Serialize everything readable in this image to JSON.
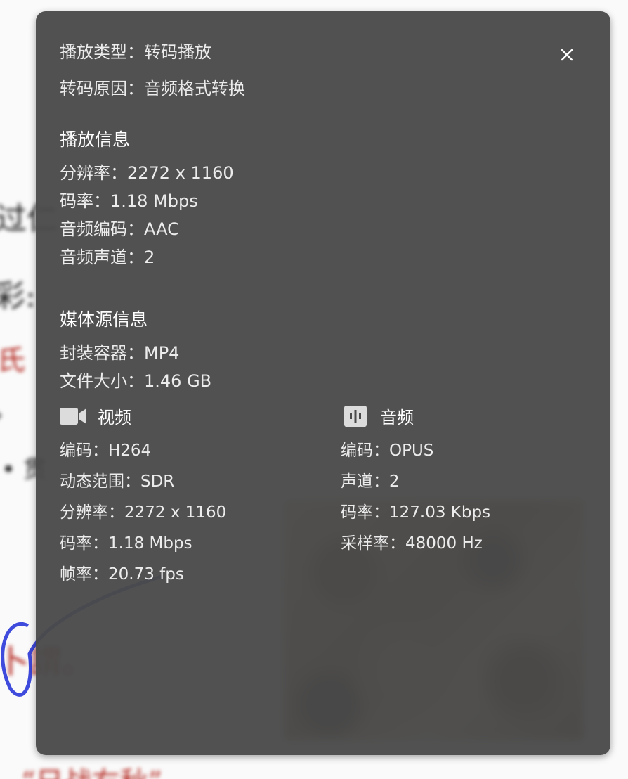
{
  "panel": {
    "play_type": "播放类型：转码播放",
    "transcode_reason": "转码原因：音频格式转换",
    "playback_info": {
      "title": "播放信息",
      "resolution": "分辨率：2272 x 1160",
      "bitrate": "码率：1.18 Mbps",
      "audio_codec": "音频编码：AAC",
      "audio_channels": "音频声道：2"
    },
    "media_source": {
      "title": "媒体源信息",
      "container": "封装容器：MP4",
      "file_size": "文件大小：1.46 GB"
    },
    "video": {
      "title": "视频",
      "icon": "video-camera-icon",
      "codec": "编码：H264",
      "dynamic_range": "动态范围：SDR",
      "resolution": "分辨率：2272 x 1160",
      "bitrate": "码率：1.18 Mbps",
      "framerate": "帧率：20.73 fps"
    },
    "audio": {
      "title": "音频",
      "icon": "audio-waveform-icon",
      "codec": "编码：OPUS",
      "channels": "声道：2",
      "bitrate": "码率：127.03 Kbps",
      "sample_rate": "采样率：48000 Hz"
    },
    "close_icon": "close-icon"
  },
  "colors": {
    "panel_bg": "#4a4a4a",
    "text": "#ececec",
    "heading": "#ffffff"
  }
}
